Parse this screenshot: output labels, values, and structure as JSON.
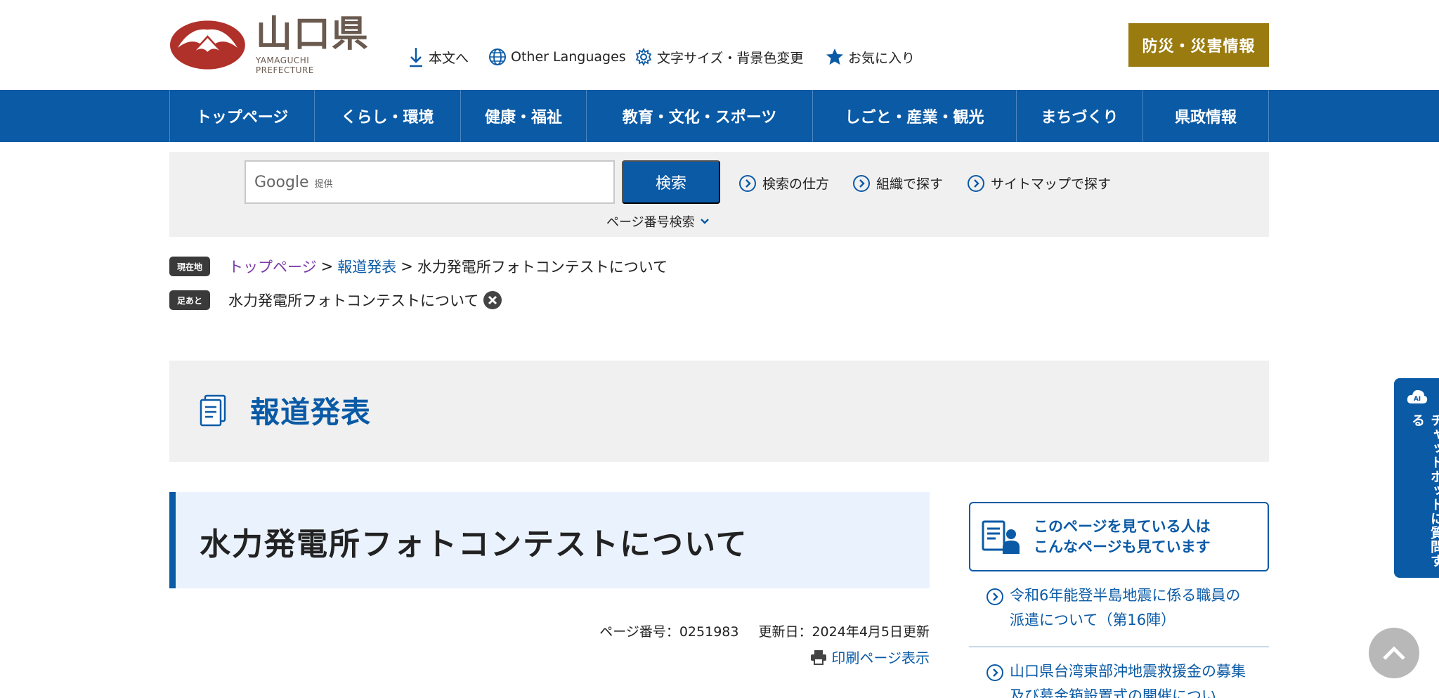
{
  "header": {
    "logo_jp": "山口県",
    "logo_en": "YAMAGUCHI PREFECTURE",
    "skip_to_content": "本文へ",
    "other_languages": "Other Languages",
    "text_size": "文字サイズ・背景色変更",
    "favorites": "お気に入り",
    "disaster_info": "防災・災害情報"
  },
  "nav": {
    "items": [
      {
        "label": "トップページ"
      },
      {
        "label": "くらし・環境"
      },
      {
        "label": "健康・福祉"
      },
      {
        "label": "教育・文化・スポーツ"
      },
      {
        "label": "しごと・産業・観光"
      },
      {
        "label": "まちづくり"
      },
      {
        "label": "県政情報"
      }
    ]
  },
  "search": {
    "google_label": "Google",
    "google_sub": "提供",
    "button": "検索",
    "how_to": "検索の仕方",
    "by_org": "組織で探す",
    "by_sitemap": "サイトマップで探す",
    "page_number_search": "ページ番号検索"
  },
  "breadcrumb": {
    "current_tag": "現在地",
    "items": [
      "トップページ",
      "報道発表",
      "水力発電所フォトコンテストについて"
    ],
    "sep": ">",
    "history_tag": "足あと",
    "history_item": "水力発電所フォトコンテストについて"
  },
  "category": {
    "title": "報道発表"
  },
  "page": {
    "title": "水力発電所フォトコンテストについて",
    "page_number": "ページ番号：0251983",
    "updated": "更新日：2024年4月5日更新",
    "print": "印刷ページ表示"
  },
  "sidebar": {
    "related_title_1": "このページを見ている人は",
    "related_title_2": "こんなページも見ています",
    "links": [
      "令和6年能登半島地震に係る職員の派遣について（第16陣）",
      "山口県台湾東部沖地震救援金の募集及び募金箱設置式の開催につい"
    ]
  },
  "chatbot": {
    "label": "チャットボットに質問する"
  },
  "colors": {
    "primary": "#0a5aa6",
    "disaster": "#9a7b10",
    "logo_red": "#b0302a",
    "band_gray": "#f0f0f0",
    "heading_bg": "#eaf3fd"
  }
}
